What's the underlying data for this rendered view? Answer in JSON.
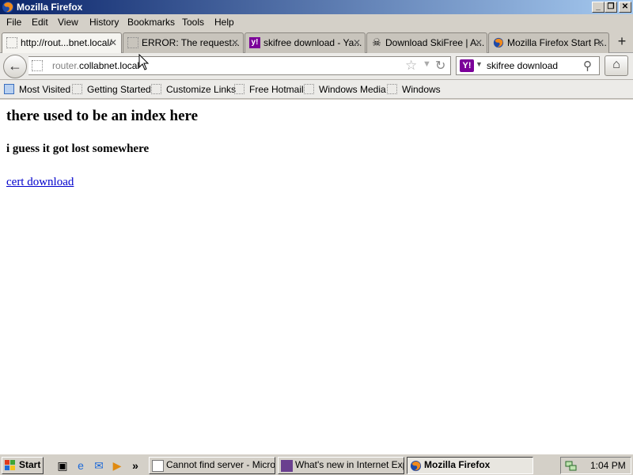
{
  "window": {
    "title": "Mozilla Firefox",
    "controls": [
      "_",
      "❐",
      "✕"
    ]
  },
  "menu": [
    "File",
    "Edit",
    "View",
    "History",
    "Bookmarks",
    "Tools",
    "Help"
  ],
  "tabs": [
    {
      "label": "http://rout...bnet.local/",
      "icon": "blank-page-icon",
      "active": true
    },
    {
      "label": "ERROR: The request...",
      "icon": "blank-page-icon"
    },
    {
      "label": "skifree download - Ya...",
      "icon": "yahoo-icon"
    },
    {
      "label": "Download SkiFree | A...",
      "icon": "skull-icon"
    },
    {
      "label": "Mozilla Firefox Start P...",
      "icon": "firefox-icon"
    }
  ],
  "nav": {
    "url_dim": "router.",
    "url_main": "collabnet.local",
    "search_value": "skifree download",
    "search_engine_icon": "Y!"
  },
  "bookmarks": [
    "Most Visited",
    "Getting Started",
    "Customize Links",
    "Free Hotmail",
    "Windows Media",
    "Windows"
  ],
  "page": {
    "heading": "there used to be an index here",
    "subheading": "i guess it got lost somewhere",
    "link": "cert download"
  },
  "taskbar": {
    "start": "Start",
    "buttons": [
      {
        "label": "Cannot find server - Micros..."
      },
      {
        "label": "What's new in Internet Exp..."
      },
      {
        "label": "Mozilla Firefox",
        "active": true
      }
    ],
    "quicklaunch_overflow": "»",
    "clock": "1:04 PM"
  },
  "colors": {
    "titlebar_start": "#0a246a",
    "titlebar_end": "#a6caf0",
    "link": "#0000cc"
  }
}
